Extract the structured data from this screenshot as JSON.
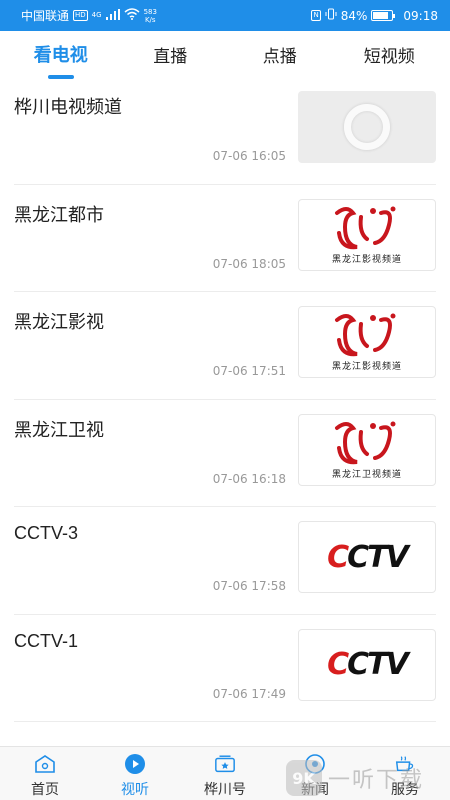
{
  "status_bar": {
    "carrier": "中国联通",
    "hd_tag": "HD",
    "network": "4G",
    "speed_value": "583",
    "speed_unit": "K/s",
    "nfc": "N",
    "battery": "84%",
    "battery_level": 0.84,
    "time": "09:18"
  },
  "top_tabs": [
    {
      "label": "看电视",
      "active": true
    },
    {
      "label": "直播",
      "active": false
    },
    {
      "label": "点播",
      "active": false
    },
    {
      "label": "短视频",
      "active": false
    }
  ],
  "channels": [
    {
      "title": "桦川电视频道",
      "time": "07-06 16:05",
      "thumb": "loading-ring"
    },
    {
      "title": "黑龙江都市",
      "time": "07-06 18:05",
      "thumb": "hlj-logo",
      "caption": "黑龙江影视频道"
    },
    {
      "title": "黑龙江影视",
      "time": "07-06 17:51",
      "thumb": "hlj-logo",
      "caption": "黑龙江影视频道"
    },
    {
      "title": "黑龙江卫视",
      "time": "07-06 16:18",
      "thumb": "hlj-logo",
      "caption": "黑龙江卫视频道"
    },
    {
      "title": "CCTV-3",
      "time": "07-06 17:58",
      "thumb": "cctv-logo",
      "logo_text": "CCTV"
    },
    {
      "title": "CCTV-1",
      "time": "07-06 17:49",
      "thumb": "cctv-logo",
      "logo_text": "CCTV"
    }
  ],
  "bottom_nav": [
    {
      "label": "首页",
      "icon": "home-icon",
      "active": false
    },
    {
      "label": "视听",
      "icon": "play-icon",
      "active": true
    },
    {
      "label": "桦川号",
      "icon": "badge-icon",
      "active": false
    },
    {
      "label": "新闻",
      "icon": "news-icon",
      "active": false
    },
    {
      "label": "服务",
      "icon": "cup-icon",
      "active": false
    }
  ],
  "watermark": {
    "logo_text": "9K",
    "text": "一听下载"
  },
  "colors": {
    "accent": "#1f8ee8",
    "cctv_red": "#d81e1e",
    "hlj_red": "#c8161d"
  }
}
